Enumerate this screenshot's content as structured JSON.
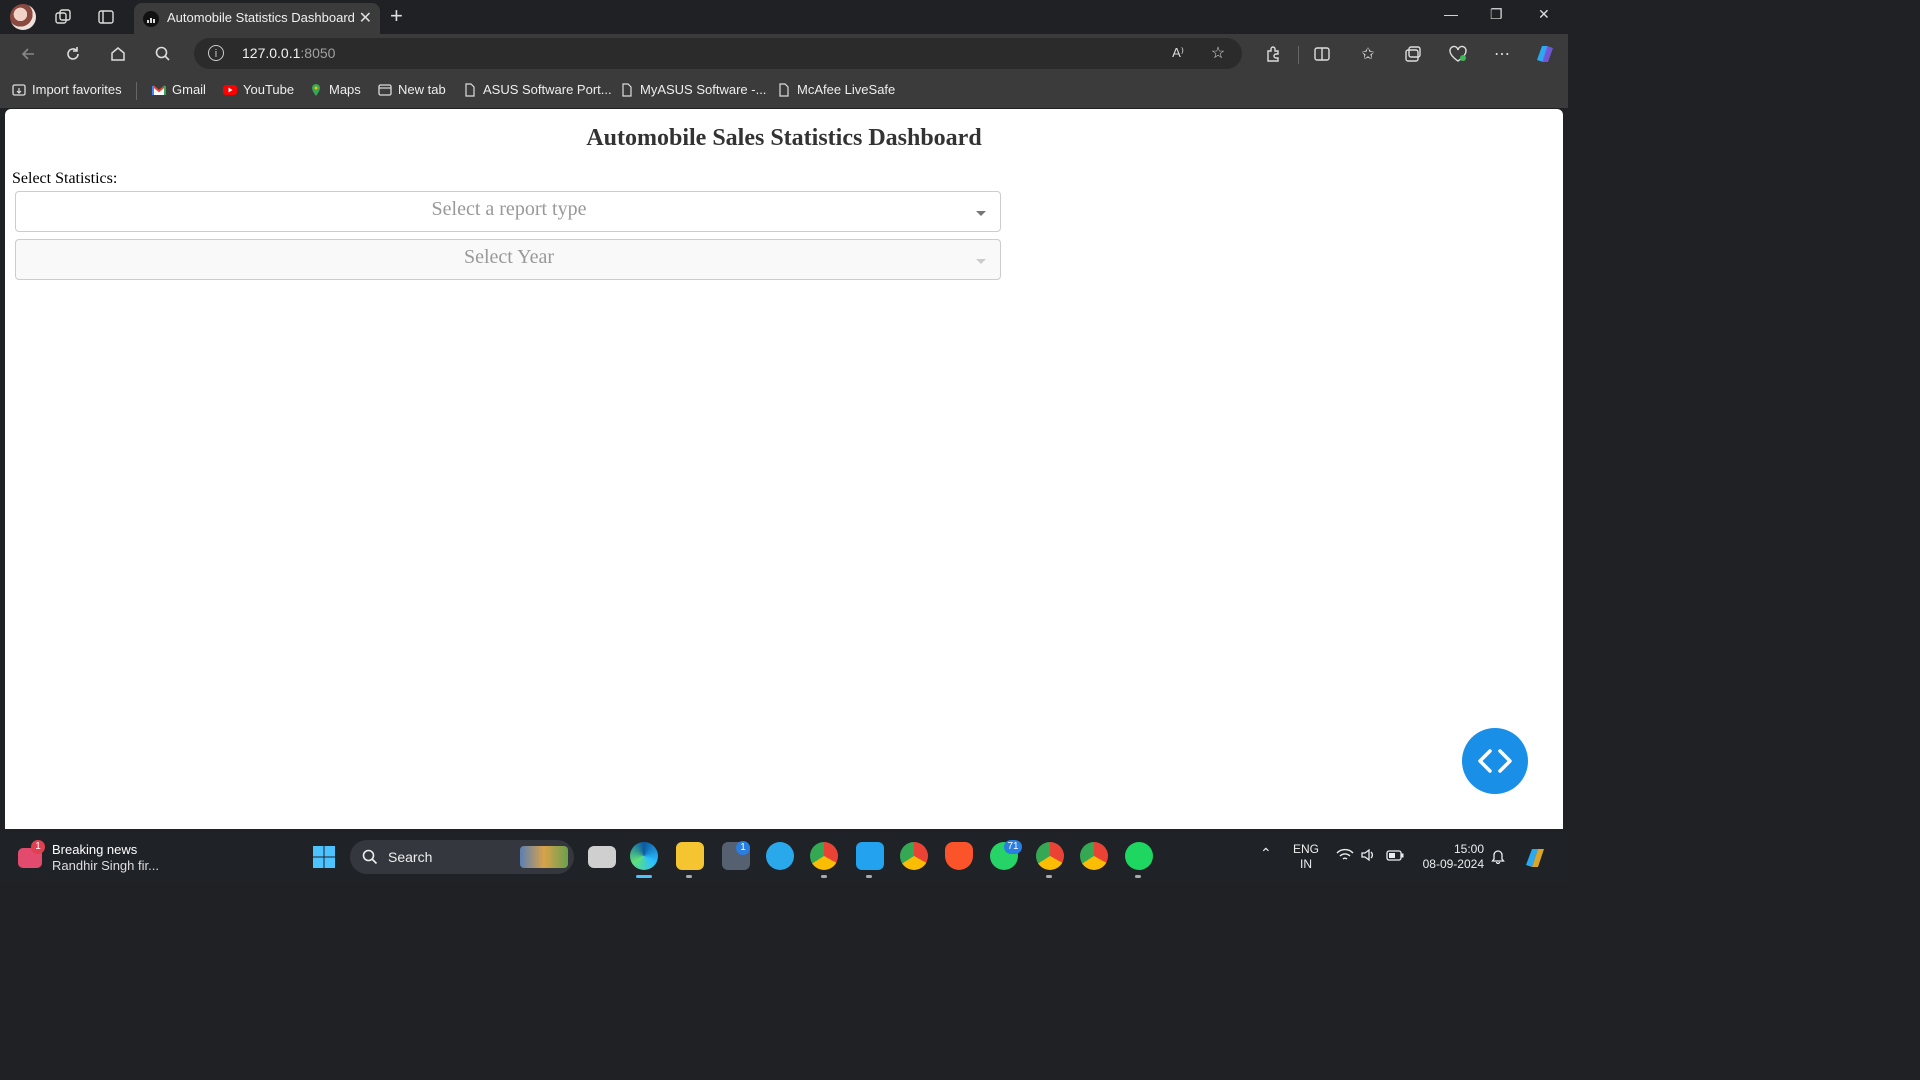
{
  "browser": {
    "tab_title": "Automobile Statistics Dashboard",
    "address_host": "127.0.0.1",
    "address_port": ":8050"
  },
  "bookmarks": [
    {
      "label": "Import favorites",
      "icon": "import-icon"
    },
    {
      "label": "Gmail",
      "icon": "gmail-icon"
    },
    {
      "label": "YouTube",
      "icon": "youtube-icon"
    },
    {
      "label": "Maps",
      "icon": "maps-icon"
    },
    {
      "label": "New tab",
      "icon": "newtab-icon"
    },
    {
      "label": "ASUS Software Port...",
      "icon": "page-icon"
    },
    {
      "label": "MyASUS Software -...",
      "icon": "page-icon"
    },
    {
      "label": "McAfee LiveSafe",
      "icon": "page-icon"
    }
  ],
  "dashboard": {
    "title": "Automobile Sales Statistics Dashboard",
    "select_label": "Select Statistics:",
    "report_dropdown_placeholder": "Select a report type",
    "year_dropdown_placeholder": "Select Year"
  },
  "taskbar": {
    "news_badge": "1",
    "news_title": "Breaking news",
    "news_subtitle": "Randhir Singh fir...",
    "search_label": "Search",
    "telegram_badge": "1",
    "whatsapp_badge": "71",
    "lang_top": "ENG",
    "lang_bottom": "IN",
    "time": "15:00",
    "date": "08-09-2024"
  },
  "colors": {
    "accent": "#1a8fe8",
    "browser_chrome": "#3b3b3b",
    "titlebar": "#202124",
    "taskbar": "#1f2328"
  }
}
